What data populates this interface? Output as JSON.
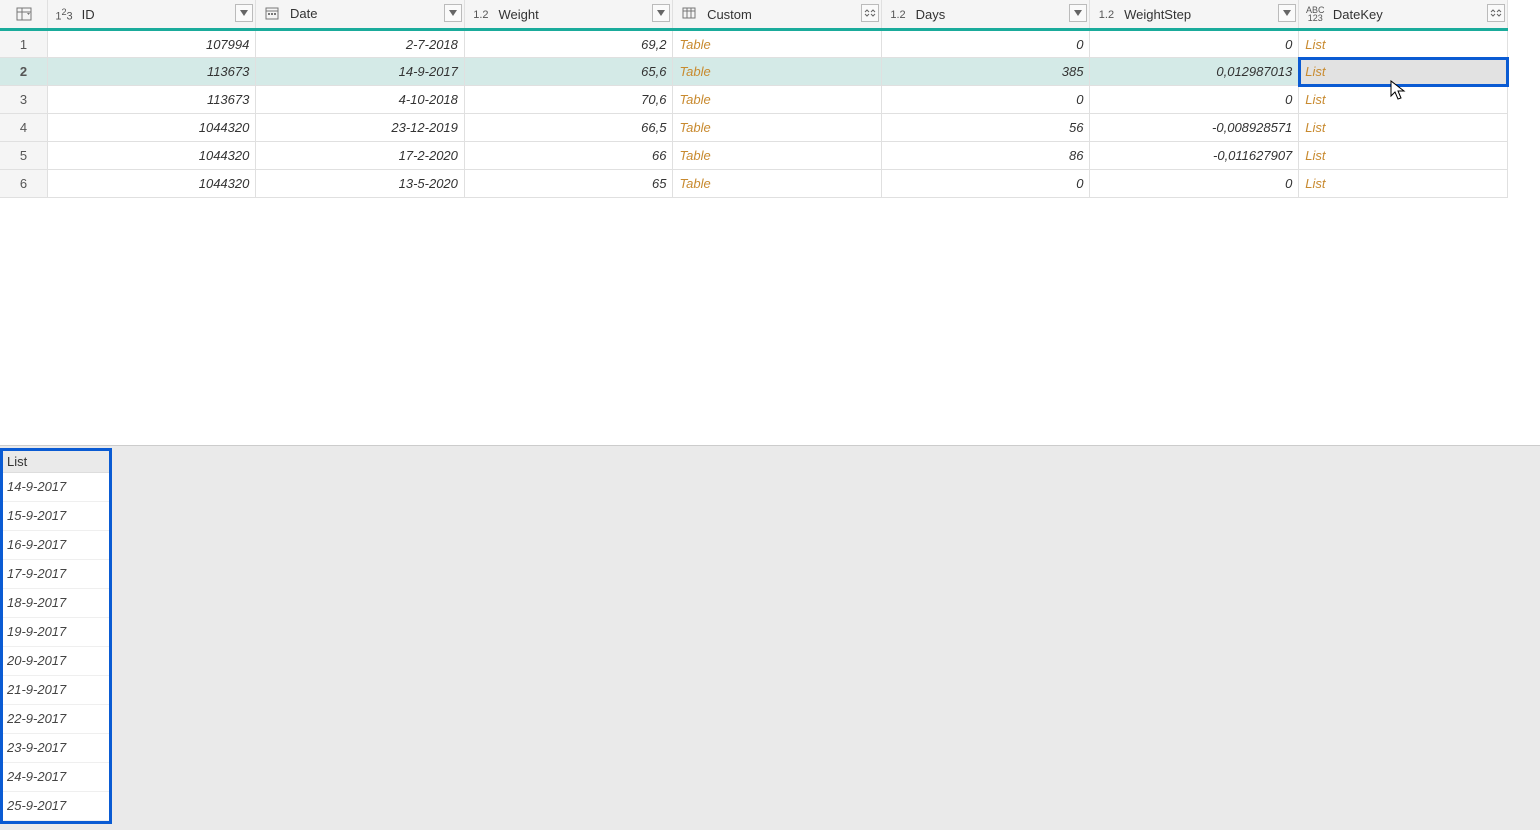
{
  "columns": {
    "id": {
      "label": "ID",
      "type": "123"
    },
    "date": {
      "label": "Date",
      "type": "cal"
    },
    "weight": {
      "label": "Weight",
      "type": "1.2"
    },
    "custom": {
      "label": "Custom",
      "type": "tbl"
    },
    "days": {
      "label": "Days",
      "type": "1.2"
    },
    "weightstep": {
      "label": "WeightStep",
      "type": "1.2"
    },
    "datekey": {
      "label": "DateKey",
      "type": "ABC123"
    }
  },
  "rows": [
    {
      "n": "1",
      "id": "107994",
      "date": "2-7-2018",
      "weight": "69,2",
      "custom": "Table",
      "days": "0",
      "step": "0",
      "key": "List"
    },
    {
      "n": "2",
      "id": "113673",
      "date": "14-9-2017",
      "weight": "65,6",
      "custom": "Table",
      "days": "385",
      "step": "0,012987013",
      "key": "List"
    },
    {
      "n": "3",
      "id": "113673",
      "date": "4-10-2018",
      "weight": "70,6",
      "custom": "Table",
      "days": "0",
      "step": "0",
      "key": "List"
    },
    {
      "n": "4",
      "id": "1044320",
      "date": "23-12-2019",
      "weight": "66,5",
      "custom": "Table",
      "days": "56",
      "step": "-0,008928571",
      "key": "List"
    },
    {
      "n": "5",
      "id": "1044320",
      "date": "17-2-2020",
      "weight": "66",
      "custom": "Table",
      "days": "86",
      "step": "-0,011627907",
      "key": "List"
    },
    {
      "n": "6",
      "id": "1044320",
      "date": "13-5-2020",
      "weight": "65",
      "custom": "Table",
      "days": "0",
      "step": "0",
      "key": "List"
    }
  ],
  "selected_row_index": 1,
  "preview": {
    "title": "List",
    "items": [
      "14-9-2017",
      "15-9-2017",
      "16-9-2017",
      "17-9-2017",
      "18-9-2017",
      "19-9-2017",
      "20-9-2017",
      "21-9-2017",
      "22-9-2017",
      "23-9-2017",
      "24-9-2017",
      "25-9-2017"
    ]
  }
}
